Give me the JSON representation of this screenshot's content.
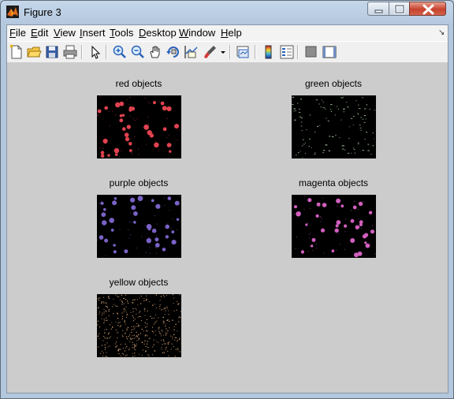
{
  "window": {
    "title": "Figure 3"
  },
  "menu": [
    {
      "key": "F",
      "rest": "ile"
    },
    {
      "key": "E",
      "rest": "dit"
    },
    {
      "key": "V",
      "rest": "iew"
    },
    {
      "key": "I",
      "rest": "nsert"
    },
    {
      "key": "T",
      "rest": "ools"
    },
    {
      "key": "D",
      "rest": "esktop"
    },
    {
      "key": "W",
      "rest": "indow"
    },
    {
      "key": "H",
      "rest": "elp"
    }
  ],
  "toolbar_icons": [
    "new-figure-icon",
    "open-file-icon",
    "save-icon",
    "print-icon",
    "edit-plot-arrow-icon",
    "zoom-in-icon",
    "zoom-out-icon",
    "pan-hand-icon",
    "rotate-3d-icon",
    "data-cursor-icon",
    "brush-icon",
    "brush-dropdown-icon",
    "link-plot-icon",
    "colorbar-icon",
    "legend-icon",
    "hide-plot-tools-icon",
    "show-plot-tools-icon"
  ],
  "plots": [
    {
      "title": "red objects",
      "color": "#e0424f",
      "style": "blob"
    },
    {
      "title": "green objects",
      "color": "#9fc39a",
      "style": "fleck"
    },
    {
      "title": "purple objects",
      "color": "#7a62c7",
      "style": "blob"
    },
    {
      "title": "magenta objects",
      "color": "#d15fbe",
      "style": "blob"
    },
    {
      "title": "yellow objects",
      "color": "#e8b07a",
      "style": "dense"
    }
  ]
}
